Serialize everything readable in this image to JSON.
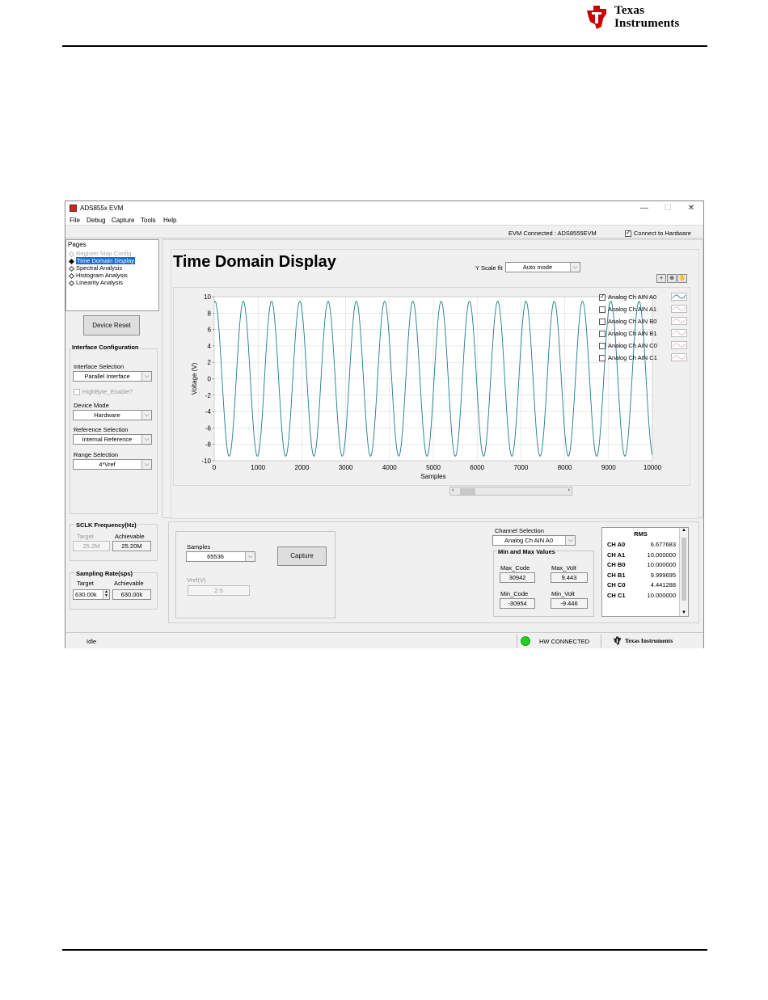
{
  "doc": {
    "logo_line1": "Texas",
    "logo_line2": "Instruments"
  },
  "window": {
    "title": "ADS855x EVM",
    "controls": [
      "—",
      "☐",
      "✕"
    ],
    "menu": [
      "File",
      "Debug",
      "Capture",
      "Tools",
      "Help"
    ],
    "evm_connected": "EVM Connected : ADS8555EVM",
    "connect_hw_label": "Connect to Hardware",
    "connect_hw_checked": true
  },
  "pages": {
    "header": "Pages",
    "items": [
      {
        "label": "Register Map Config",
        "state": "disabled"
      },
      {
        "label": "Time Domain Display",
        "state": "selected"
      },
      {
        "label": "Spectral Analysis",
        "state": "normal"
      },
      {
        "label": "Histogram Analysis",
        "state": "normal"
      },
      {
        "label": "Linearity Analysis",
        "state": "normal"
      }
    ]
  },
  "left": {
    "device_reset": "Device Reset",
    "interface_config_title": "Interface Configuration",
    "interface_selection_label": "Interface Selection",
    "interface_selection_value": "Parallel Interface",
    "highbyte_label": "HighByte_Enable?",
    "device_mode_label": "Device Mode",
    "device_mode_value": "Hardware",
    "reference_label": "Reference Selection",
    "reference_value": "Internal Reference",
    "range_label": "Range Selection",
    "range_value": "4*Vref",
    "sclk_title": "SCLK Frequency(Hz)",
    "sclk_target_label": "Target",
    "sclk_achievable_label": "Achievable",
    "sclk_target_value": "25.2M",
    "sclk_achievable_value": "25.20M",
    "sampling_title": "Sampling Rate(sps)",
    "sampling_target_label": "Target",
    "sampling_achievable_label": "Achievable",
    "sampling_target_value": "630.00k",
    "sampling_achievable_value": "630.00k"
  },
  "plot": {
    "title": "Time Domain Display",
    "yscale_label": "Y Scale fit",
    "yscale_value": "Auto mode",
    "tools": [
      "+",
      "⊕",
      "✋"
    ],
    "legend": [
      {
        "label": "Analog Ch AIN A0",
        "checked": true
      },
      {
        "label": "Analog Ch AIN A1",
        "checked": false
      },
      {
        "label": "Analog Ch AIN B0",
        "checked": false
      },
      {
        "label": "Analog Ch AIN B1",
        "checked": false
      },
      {
        "label": "Analog Ch AIN C0",
        "checked": false
      },
      {
        "label": "Analog Ch AIN C1",
        "checked": false
      }
    ]
  },
  "chart_data": {
    "type": "line",
    "xlabel": "Samples",
    "ylabel": "Voltage (V)",
    "xlim": [
      0,
      10000
    ],
    "ylim": [
      -10,
      10
    ],
    "x_ticks": [
      0,
      1000,
      2000,
      3000,
      4000,
      5000,
      6000,
      7000,
      8000,
      9000,
      10000
    ],
    "y_ticks": [
      10,
      8,
      6,
      4,
      2,
      0,
      -2,
      -4,
      -6,
      -8,
      -10
    ],
    "grid": true,
    "series": [
      {
        "name": "Analog Ch AIN A0",
        "amplitude": 9.44,
        "cycles_in_view": 15.5,
        "phase_deg": 80,
        "x_end": 10000,
        "color": "#1f7c8c"
      }
    ]
  },
  "bottom": {
    "samples_label": "Samples",
    "samples_value": "65536",
    "capture_button": "Capture",
    "vref_label": "Vref(V)",
    "vref_value": "2.5",
    "channel_selection_label": "Channel Selection",
    "channel_selection_value": "Analog Ch AIN A0",
    "minmax_title": "Min and Max Values",
    "max_code_label": "Max_Code",
    "max_code_value": "30942",
    "max_volt_label": "Max_Volt",
    "max_volt_value": "9.443",
    "min_code_label": "Min_Code",
    "min_code_value": "-30954",
    "min_volt_label": "Min_Volt",
    "min_volt_value": "-9.446",
    "rms_header": "RMS",
    "rms_rows": [
      {
        "ch": "CH A0",
        "v": "6.677683"
      },
      {
        "ch": "CH A1",
        "v": "10.000000"
      },
      {
        "ch": "CH B0",
        "v": "10.000000"
      },
      {
        "ch": "CH B1",
        "v": "9.999695"
      },
      {
        "ch": "CH C0",
        "v": "4.441288"
      },
      {
        "ch": "CH C1",
        "v": "10.000000"
      }
    ]
  },
  "status": {
    "idle": "Idle",
    "hw_connected": "HW CONNECTED",
    "ti_label": "Texas Instruments"
  }
}
